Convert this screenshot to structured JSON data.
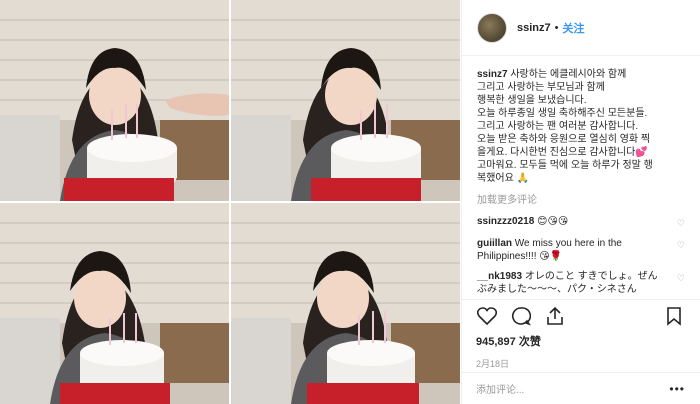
{
  "post": {
    "username": "ssinz7",
    "separator": "•",
    "follow_label": "关注",
    "caption_lines": [
      "사랑하는 에클레시아와 함께",
      "그리고 사랑하는 부모님과 함께",
      "행복한 생일을 보냈습니다.",
      "오늘 하루종일 생일 축하해주신 모든분들.",
      "그리고 사랑하는 팬 여러분 감사합니다.",
      "오늘 받은 축하와 응원으로 열심히 영화 찍",
      "을게요. 다시한번 진심으로 감사합니다💕",
      "고마워요. 모두들 먹에 오늘 하루가 정말 행",
      "복했어요 🙏"
    ],
    "load_more": "加载更多评论",
    "comments": [
      {
        "user": "ssinzzz0218",
        "text": " 😊😘😘"
      },
      {
        "user": "guiillan",
        "text": " We miss you here in the Philippines!!!! 😘🌹"
      },
      {
        "user": "__nk1983",
        "text": " オレのこと すきでしょ。ぜんぶみました〜〜〜、パク・シネさん"
      }
    ],
    "likes": "945,897 次赞",
    "date": "2月18日",
    "add_comment_placeholder": "添加评论...",
    "more_dots": "•••"
  },
  "colors": {
    "accent": "#3897f0",
    "text": "#262626",
    "muted": "#999999",
    "border": "#efefef"
  },
  "icons": [
    "heart-icon",
    "comment-icon",
    "share-icon",
    "bookmark-icon",
    "small-heart-icon"
  ]
}
